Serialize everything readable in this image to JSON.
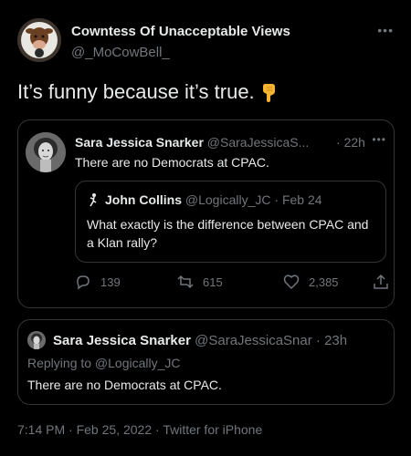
{
  "colors": {
    "background": "#000000",
    "text": "#e7e9ea",
    "muted": "#71767b",
    "border": "#333639"
  },
  "author": {
    "name": "Cowntess Of Unacceptable Views",
    "handle": "@_MoCowBell_",
    "avatar_icon": "cow-avatar"
  },
  "tweet": {
    "text": "It’s funny because it’s true.",
    "emoji_icon": "pointing-down-hand-emoji"
  },
  "quote": {
    "name": "Sara Jessica Snarker",
    "handle": "@SaraJessicaS...",
    "sep": " · ",
    "time": "22h",
    "text": "There are no Democrats at CPAC.",
    "nested": {
      "name": "John Collins",
      "handle": "@Logically_JC",
      "date": "Feb 24",
      "text": "What exactly is the difference between CPAC and a Klan rally?"
    },
    "actions": {
      "replies": "139",
      "retweets": "615",
      "likes": "2,385"
    }
  },
  "reply": {
    "name": "Sara Jessica Snarker",
    "handle": "@SaraJessicaSnar",
    "time": "23h",
    "replying_to": "Replying to @Logically_JC",
    "text": "There are no Democrats at CPAC."
  },
  "meta": {
    "time": "7:14 PM",
    "date": "Feb 25, 2022",
    "client": "Twitter for iPhone"
  }
}
